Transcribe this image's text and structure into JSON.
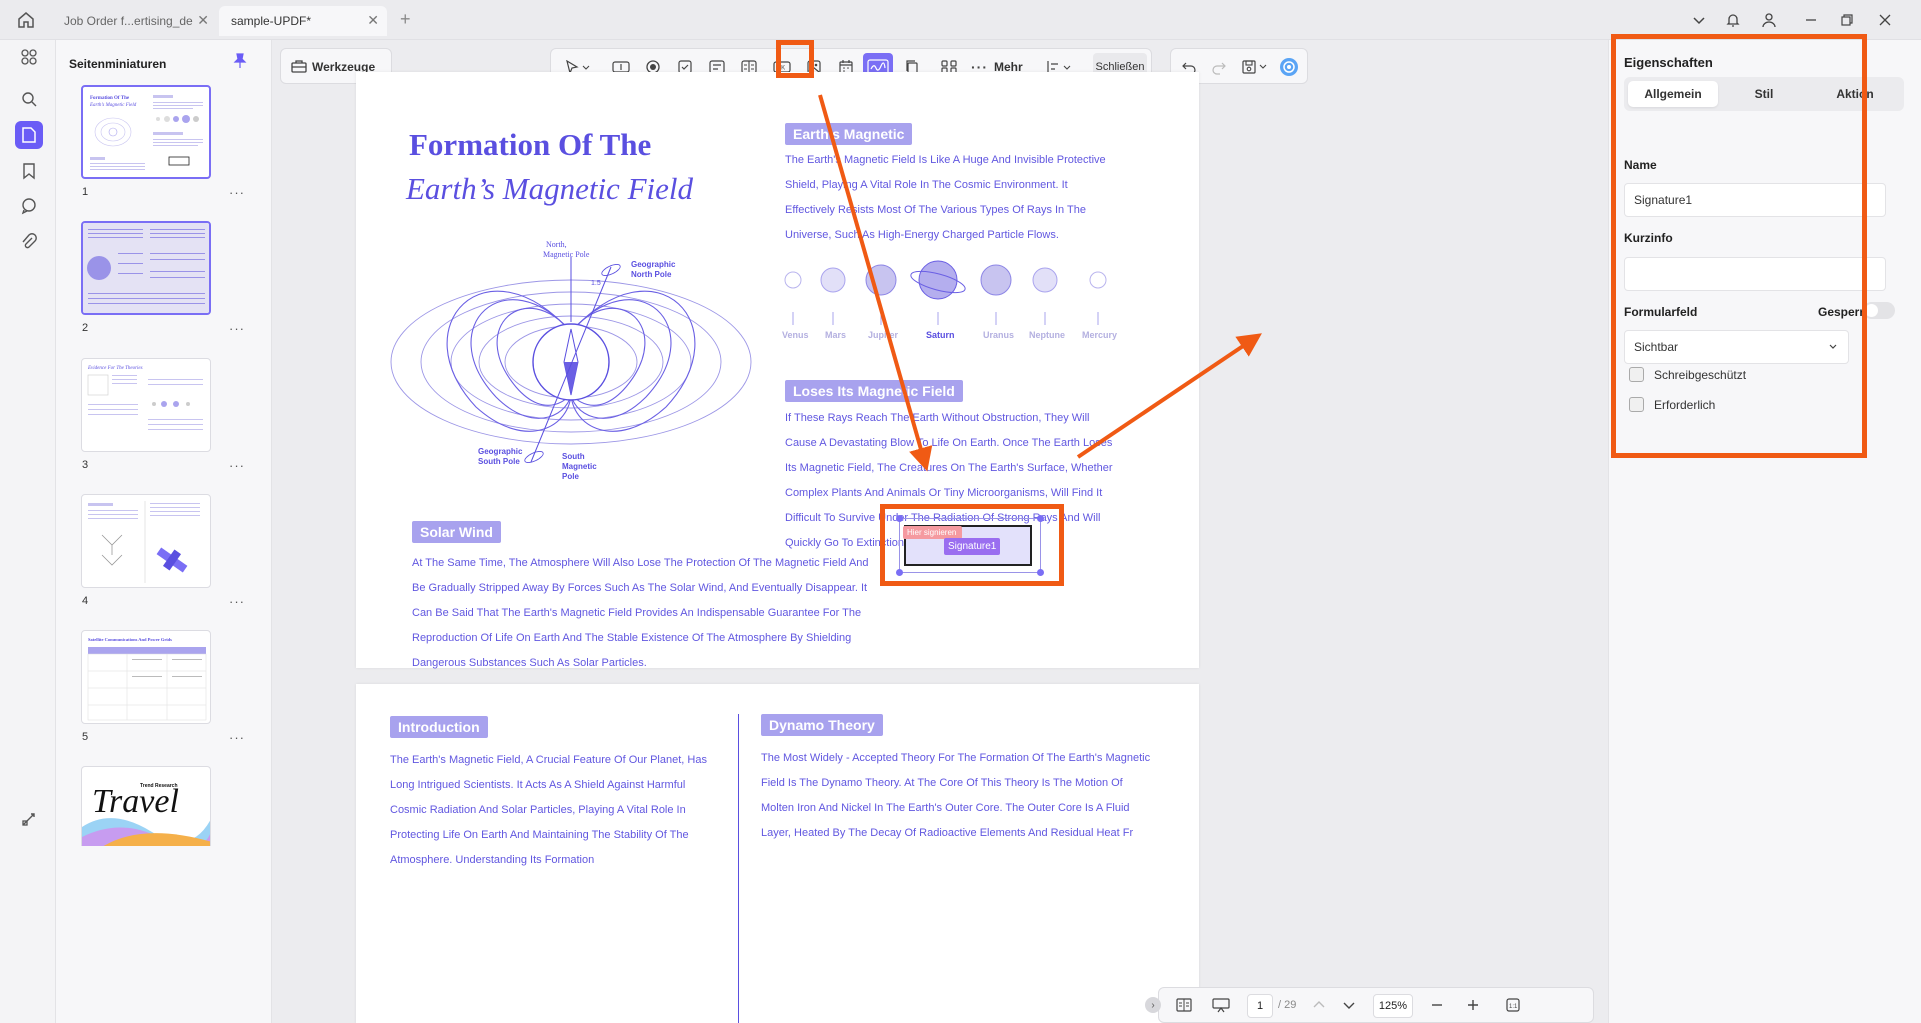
{
  "tabs": [
    {
      "title": "Job Order f...ertising_de"
    },
    {
      "title": "sample-UPDF*"
    }
  ],
  "sidebar": {
    "title": "Seitenminiaturen",
    "pages": [
      "1",
      "2",
      "3",
      "4",
      "5"
    ],
    "more": "···"
  },
  "toolbar": {
    "tools_label": "Werkzeuge",
    "more_label": "Mehr",
    "close_label": "Schließen",
    "zoom": "125%",
    "page_current": "1",
    "page_total": "/ 29"
  },
  "document": {
    "title_line1": "Formation Of The",
    "title_line2": "Earth’s Magnetic Field",
    "diagram_labels": {
      "north_pole": "North\nMagnetic Pole",
      "geo_north": "Geographic\nNorth Pole",
      "geo_south": "Geographic\nSouth Pole",
      "south_pole": "South\nMagnetic\nPole",
      "angle": "1.5"
    },
    "sec_earth": "Earth's Magnetic",
    "earth_text": "The Earth's Magnetic Field Is Like A Huge And Invisible Protective Shield, Playing A Vital Role In The Cosmic Environment. It Effectively Resists Most Of The Various Types Of Rays In The Universe, Such As High-Energy Charged Particle Flows.",
    "planets": [
      "Venus",
      "Mars",
      "Jupiter",
      "Saturn",
      "Uranus",
      "Neptune",
      "Mercury"
    ],
    "sec_loses": "Loses Its Magnetic Field",
    "loses_text": "If These Rays Reach The Earth Without Obstruction, They Will Cause A Devastating Blow To Life On Earth. Once The Earth Loses Its Magnetic Field, The Creatures On The Earth's Surface, Whether Complex Plants And Animals Or Tiny Microorganisms, Will Find It Difficult To Survive Under The Radiation Of Strong Rays And Will Quickly Go To Extinction.",
    "sec_solar": "Solar Wind",
    "solar_text": "At The Same Time, The Atmosphere Will Also Lose The Protection Of The Magnetic Field And Be Gradually Stripped Away By Forces Such As The Solar Wind, And Eventually Disappear. It Can Be Said That The Earth's Magnetic Field Provides An Indispensable Guarantee For The Reproduction Of Life On Earth And The Stable Existence Of The Atmosphere By Shielding Dangerous Substances Such As Solar Particles.",
    "signature_hint": "Hier signieren",
    "signature_name": "Signature1",
    "sec_intro": "Introduction",
    "intro_text": "The Earth's Magnetic Field, A Crucial Feature Of Our Planet, Has Long Intrigued Scientists. It Acts As A Shield Against Harmful Cosmic Radiation And Solar Particles, Playing A Vital Role In Protecting Life On Earth And Maintaining The Stability Of The Atmosphere. Understanding Its Formation",
    "sec_dynamo": "Dynamo Theory",
    "dynamo_text": "The Most Widely - Accepted Theory For The Formation Of The Earth's Magnetic Field Is The Dynamo Theory. At The Core Of This Theory Is The Motion Of Molten Iron And Nickel In The Earth's Outer Core. The Outer Core Is A Fluid Layer, Heated By The Decay Of Radioactive Elements And Residual Heat Fr"
  },
  "thumb_travel": {
    "title": "Travel",
    "subtitle": "Trend Research",
    "p3_title": "Evidence For The Theories",
    "p5_title": "Satellite Communications And Power Grids"
  },
  "properties": {
    "title": "Eigenschaften",
    "tabs": [
      "Allgemein",
      "Stil",
      "Aktion"
    ],
    "name_label": "Name",
    "name_value": "Signature1",
    "tooltip_label": "Kurzinfo",
    "tooltip_value": "",
    "field_label": "Formularfeld",
    "locked_label": "Gesperrt",
    "visibility": "Sichtbar",
    "readonly_label": "Schreibgeschützt",
    "required_label": "Erforderlich"
  },
  "colors": {
    "accent": "#6a5cf6",
    "annotation": "#f05a14",
    "doc_text": "#6157e0"
  }
}
